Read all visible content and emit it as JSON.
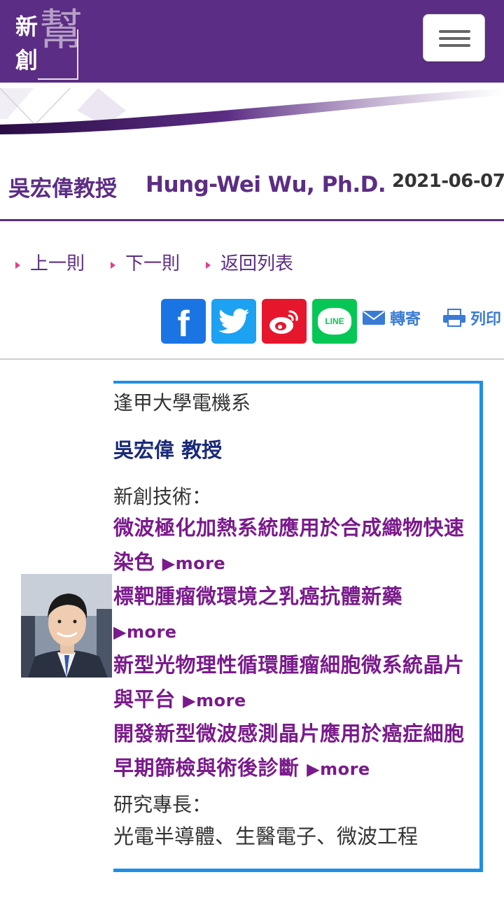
{
  "header": {
    "logo_text": [
      "新",
      "創",
      "幫"
    ],
    "menu_label": "menu"
  },
  "article": {
    "title_zh": "吳宏偉教授",
    "title_en": "Hung-Wei Wu, Ph.D.",
    "date": "2021-06-07"
  },
  "nav": {
    "prev": "上一則",
    "next": "下一則",
    "back": "返回列表"
  },
  "share": {
    "facebook": "f",
    "line": "LINE",
    "forward": "轉寄",
    "print": "列印"
  },
  "profile": {
    "department": "逢甲大學電機系",
    "name": "吳宏偉 教授",
    "tech_label": "新創技術：",
    "technologies": [
      {
        "title": "微波極化加熱系統應用於合成織物快速染色",
        "more": "▶more"
      },
      {
        "title": "標靶腫瘤微環境之乳癌抗體新藥",
        "more": "▶more"
      },
      {
        "title": "新型光物理性循環腫瘤細胞微系統晶片與平台",
        "more": "▶more"
      },
      {
        "title": "開發新型微波感測晶片應用於癌症細胞早期篩檢與術後診斷",
        "more": "▶more"
      }
    ],
    "expertise_label": "研究專長：",
    "expertise": "光電半導體、生醫電子、微波工程"
  },
  "colors": {
    "brand_purple": "#5c2d84",
    "link_purple": "#7a1a8c",
    "name_navy": "#1a2a7a",
    "card_border": "#1e8fe6",
    "facebook": "#1b74e4",
    "twitter": "#1da1f2",
    "weibo": "#e6162d",
    "line": "#06c755"
  }
}
